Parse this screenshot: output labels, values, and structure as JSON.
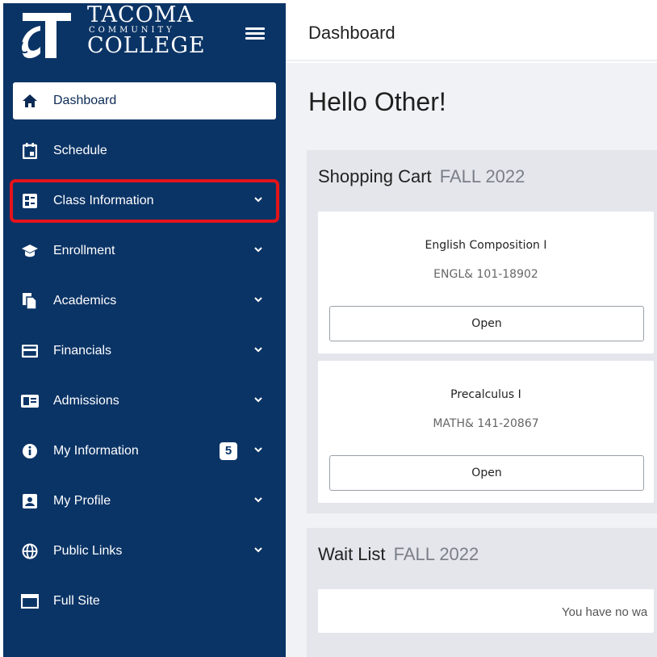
{
  "brand": {
    "line1": "TACOMA",
    "line2": "COMMUNITY",
    "line3": "COLLEGE",
    "menu_icon": "hamburger-menu-icon"
  },
  "colors": {
    "sidebar_bg": "#0b3466",
    "highlight_outline": "#e3141b",
    "main_bg": "#f1f2f5",
    "panel_bg": "#e4e6ec"
  },
  "sidebar": {
    "items": [
      {
        "label": "Dashboard",
        "icon": "home-icon",
        "active": true
      },
      {
        "label": "Schedule",
        "icon": "calendar-icon"
      },
      {
        "label": "Class Information",
        "icon": "class-list-icon",
        "expandable": true,
        "highlighted": true
      },
      {
        "label": "Enrollment",
        "icon": "graduation-cap-icon",
        "expandable": true
      },
      {
        "label": "Academics",
        "icon": "documents-icon",
        "expandable": true
      },
      {
        "label": "Financials",
        "icon": "credit-card-icon",
        "expandable": true
      },
      {
        "label": "Admissions",
        "icon": "id-card-icon",
        "expandable": true
      },
      {
        "label": "My Information",
        "icon": "info-icon",
        "expandable": true,
        "badge": "5"
      },
      {
        "label": "My Profile",
        "icon": "profile-icon",
        "expandable": true
      },
      {
        "label": "Public Links",
        "icon": "globe-icon",
        "expandable": true
      },
      {
        "label": "Full Site",
        "icon": "window-icon"
      }
    ]
  },
  "topbar": {
    "title": "Dashboard"
  },
  "main": {
    "greeting": "Hello Other!",
    "shopping_cart": {
      "title": "Shopping Cart",
      "term": "FALL 2022",
      "courses": [
        {
          "name": "English Composition I",
          "code": "ENGL& 101-18902",
          "button": "Open"
        },
        {
          "name": "Precalculus I",
          "code": "MATH& 141-20867",
          "button": "Open"
        }
      ]
    },
    "wait_list": {
      "title": "Wait List",
      "term": "FALL 2022",
      "empty_text": "You have no wa"
    }
  }
}
